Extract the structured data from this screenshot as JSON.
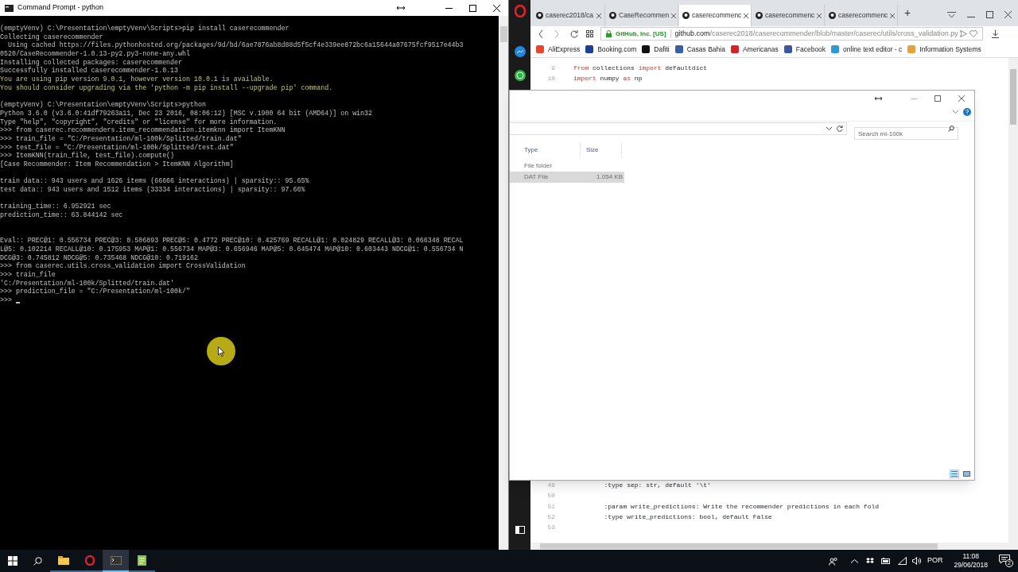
{
  "terminal": {
    "title": "Command Prompt - python",
    "lines": [
      {
        "kind": "output",
        "text": "(emptyVenv) C:\\Presentation\\emptyVenv\\Scripts>pip install caserecommender"
      },
      {
        "kind": "output",
        "text": "Collecting caserecommender"
      },
      {
        "kind": "output",
        "text": "  Using cached https://files.pythonhosted.org/packages/9d/bd/6ae7876ab8d88d5f5cf4e339ee872bc6a15644a07675fcf9517e44b3"
      },
      {
        "kind": "output",
        "text": "0520/CaseRecommender-1.0.13-py2.py3-none-any.whl"
      },
      {
        "kind": "output",
        "text": "Installing collected packages: caserecommender"
      },
      {
        "kind": "output",
        "text": "Successfully installed caserecommender-1.0.13"
      },
      {
        "kind": "warning",
        "text": "You are using pip version 9.0.1, however version 10.0.1 is available."
      },
      {
        "kind": "warning",
        "text": "You should consider upgrading via the 'python -m pip install --upgrade pip' command."
      },
      {
        "kind": "blank"
      },
      {
        "kind": "output",
        "text": "(emptyVenv) C:\\Presentation\\emptyVenv\\Scripts>python"
      },
      {
        "kind": "output",
        "text": "Python 3.6.0 (v3.6.0:41df79263a11, Dec 23 2016, 08:06:12) [MSC v.1900 64 bit (AMD64)] on win32"
      },
      {
        "kind": "output",
        "text": "Type \"help\", \"copyright\", \"credits\" or \"license\" for more information."
      },
      {
        "kind": "output",
        "text": ">>> from caserec.recommenders.item_recommendation.itemknn import ItemKNN"
      },
      {
        "kind": "output",
        "text": ">>> train_file = \"C:/Presentation/ml-100k/Splitted/train.dat\""
      },
      {
        "kind": "output",
        "text": ">>> test_file = \"C:/Presentation/ml-100k/Splitted/test.dat\""
      },
      {
        "kind": "output",
        "text": ">>> ItemKNN(train_file, test_file).compute()"
      },
      {
        "kind": "output",
        "text": "[Case Recommender: Item Recommendation > ItemKNN Algorithm]"
      },
      {
        "kind": "blank"
      },
      {
        "kind": "output",
        "text": "train data:: 943 users and 1626 items (66666 interactions) | sparsity:: 95.65%"
      },
      {
        "kind": "output",
        "text": "test data:: 943 users and 1512 items (33334 interactions) | sparsity:: 97.66%"
      },
      {
        "kind": "blank"
      },
      {
        "kind": "output",
        "text": "training_time:: 6.952921 sec"
      },
      {
        "kind": "output",
        "text": "prediction_time:: 63.844142 sec"
      },
      {
        "kind": "blank"
      },
      {
        "kind": "blank"
      },
      {
        "kind": "output",
        "text": "Eval:: PREC@1: 0.556734 PREC@3: 0.506893 PREC@5: 0.4772 PREC@10: 0.425769 RECALL@1: 0.024829 RECALL@3: 0.066348 RECAL"
      },
      {
        "kind": "output",
        "text": "L@5: 0.102214 RECALL@10: 0.175953 MAP@1: 0.556734 MAP@3: 0.656946 MAP@5: 0.645474 MAP@10: 0.603443 NDCG@1: 0.556734 N"
      },
      {
        "kind": "output",
        "text": "DCG@3: 0.745812 NDCG@5: 0.735468 NDCG@10: 0.719162"
      },
      {
        "kind": "output",
        "text": ">>> from caserec.utils.cross_validation import CrossValidation"
      },
      {
        "kind": "output",
        "text": ">>> train_file"
      },
      {
        "kind": "output",
        "text": "'C:/Presentation/ml-100k/Splitted/train.dat'"
      },
      {
        "kind": "output",
        "text": ">>> prediction_file = \"C:/Presentation/ml-100k/\""
      },
      {
        "kind": "prompt",
        "text": ">>>",
        "cursor": true
      }
    ]
  },
  "browser": {
    "tabs": [
      {
        "label": "caserec2018/ca",
        "selected": false
      },
      {
        "label": "CaseRecommen",
        "selected": false
      },
      {
        "label": "caserecommenc",
        "selected": true
      },
      {
        "label": "caserecommenc",
        "selected": false
      },
      {
        "label": "caserecommenc",
        "selected": false
      }
    ],
    "security_label": "GitHub, Inc. [US]",
    "url_domain": "github.com",
    "url_path": "/caserec2018/caserecommender/blob/master/caserec/utils/cross_validation.py",
    "bookmarks": [
      {
        "label": "AliExpress",
        "color": "#e8452c"
      },
      {
        "label": "Booking.com",
        "color": "#1d3f8f"
      },
      {
        "label": "Dafiti",
        "color": "#111111"
      },
      {
        "label": "Casas Bahia",
        "color": "#3a5fa8"
      },
      {
        "label": "Americanas",
        "color": "#d8232a"
      },
      {
        "label": "Facebook",
        "color": "#3b5998"
      },
      {
        "label": "online text editor - c",
        "color": "#2d9ad6"
      },
      {
        "label": "Information Systems",
        "color": "#e5a13c"
      }
    ],
    "code_top": [
      {
        "number": "9",
        "tokens": [
          {
            "kind": "keyword",
            "text": "from"
          },
          {
            "kind": "plain",
            "text": " collections "
          },
          {
            "kind": "keyword",
            "text": "import"
          },
          {
            "kind": "plain",
            "text": " defaultdict"
          }
        ]
      },
      {
        "number": "10",
        "tokens": [
          {
            "kind": "keyword",
            "text": "import"
          },
          {
            "kind": "plain",
            "text": " numpy "
          },
          {
            "kind": "keyword",
            "text": "as"
          },
          {
            "kind": "plain",
            "text": " np"
          }
        ]
      }
    ],
    "code_bottom": [
      {
        "number": "49",
        "tokens": [
          {
            "kind": "plain",
            "text": "        :type sep: str, default '\\t'"
          }
        ]
      },
      {
        "number": "50"
      },
      {
        "number": "51",
        "tokens": [
          {
            "kind": "plain",
            "text": "        :param write_predictions: Write the recommender predictions in each fold"
          }
        ]
      },
      {
        "number": "52",
        "tokens": [
          {
            "kind": "plain",
            "text": "        :type write_predictions: bool, default False"
          }
        ]
      },
      {
        "number": "53"
      }
    ],
    "new_tab_label": "+"
  },
  "explorer": {
    "search": {
      "placeholder": "Search ml-100k"
    },
    "columns": [
      "Type",
      "Size"
    ],
    "rows": [
      {
        "type": "File folder",
        "selected": false
      },
      {
        "type": "DAT File",
        "size": "1.054 KB",
        "selected": true
      }
    ],
    "views": [
      {
        "kind": "details",
        "selected": true
      },
      {
        "kind": "large_icons",
        "selected": false
      }
    ]
  },
  "taskbar": {
    "apps": [
      {
        "kind": "explorer",
        "active": false
      },
      {
        "kind": "opera",
        "active": false
      },
      {
        "kind": "cmd",
        "active": true
      },
      {
        "kind": "notepad",
        "active": false
      }
    ],
    "language": "POR",
    "time": "11:08",
    "date": "29/06/2018",
    "notifications": "2"
  }
}
